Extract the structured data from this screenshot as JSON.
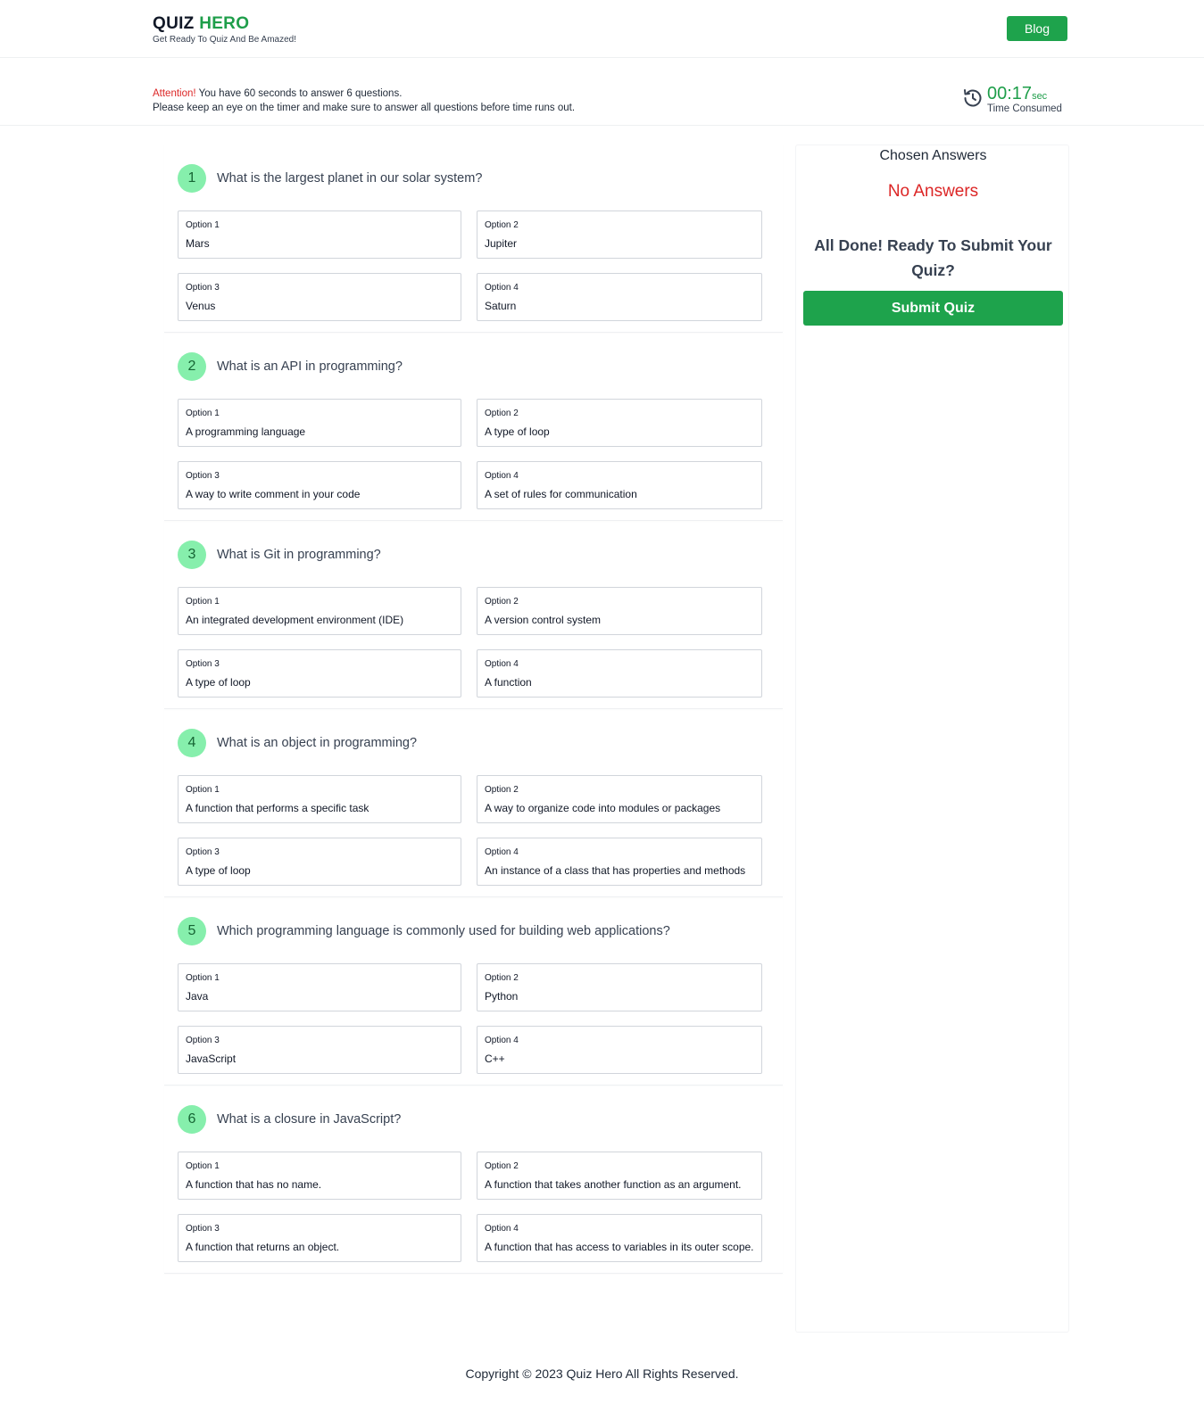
{
  "header": {
    "logo_word_1": "QUIZ",
    "logo_word_2": "HERO",
    "tagline": "Get Ready To Quiz And Be Amazed!",
    "blog_label": "Blog",
    "brand_color": "#1ea34c"
  },
  "notice": {
    "attention": "Attention!",
    "line1": " You have 60 seconds to answer 6 questions.",
    "line2": "Please keep an eye on the timer and make sure to answer all questions before time runs out."
  },
  "timer": {
    "icon": "history-clock-icon",
    "value": "00:17",
    "unit": "sec",
    "label": "Time Consumed"
  },
  "questions": [
    {
      "number": "1",
      "text": "What is the largest planet in our solar system?",
      "options": [
        {
          "label": "Option 1",
          "text": "Mars"
        },
        {
          "label": "Option 2",
          "text": "Jupiter"
        },
        {
          "label": "Option 3",
          "text": "Venus"
        },
        {
          "label": "Option 4",
          "text": "Saturn"
        }
      ]
    },
    {
      "number": "2",
      "text": "What is an API in programming?",
      "options": [
        {
          "label": "Option 1",
          "text": "A programming language"
        },
        {
          "label": "Option 2",
          "text": "A type of loop"
        },
        {
          "label": "Option 3",
          "text": "A way to write comment in your code"
        },
        {
          "label": "Option 4",
          "text": "A set of rules for communication"
        }
      ]
    },
    {
      "number": "3",
      "text": "What is Git in programming?",
      "options": [
        {
          "label": "Option 1",
          "text": "An integrated development environment (IDE)"
        },
        {
          "label": "Option 2",
          "text": "A version control system"
        },
        {
          "label": "Option 3",
          "text": "A type of loop"
        },
        {
          "label": "Option 4",
          "text": "A function"
        }
      ]
    },
    {
      "number": "4",
      "text": "What is an object in programming?",
      "options": [
        {
          "label": "Option 1",
          "text": "A function that performs a specific task"
        },
        {
          "label": "Option 2",
          "text": "A way to organize code into modules or packages"
        },
        {
          "label": "Option 3",
          "text": "A type of loop"
        },
        {
          "label": "Option 4",
          "text": "An instance of a class that has properties and methods"
        }
      ]
    },
    {
      "number": "5",
      "text": "Which programming language is commonly used for building web applications?",
      "options": [
        {
          "label": "Option 1",
          "text": "Java"
        },
        {
          "label": "Option 2",
          "text": "Python"
        },
        {
          "label": "Option 3",
          "text": "JavaScript"
        },
        {
          "label": "Option 4",
          "text": "C++"
        }
      ]
    },
    {
      "number": "6",
      "text": "What is a closure in JavaScript?",
      "options": [
        {
          "label": "Option 1",
          "text": "A function that has no name."
        },
        {
          "label": "Option 2",
          "text": "A function that takes another function as an argument."
        },
        {
          "label": "Option 3",
          "text": "A function that returns an object."
        },
        {
          "label": "Option 4",
          "text": "A function that has access to variables in its outer scope."
        }
      ]
    }
  ],
  "side": {
    "title": "Chosen Answers",
    "empty": "No Answers",
    "ready": "All Done! Ready To Submit Your Quiz?",
    "submit_label": "Submit Quiz"
  },
  "footer": {
    "copyright": "Copyright © 2023 Quiz Hero All Rights Reserved."
  }
}
